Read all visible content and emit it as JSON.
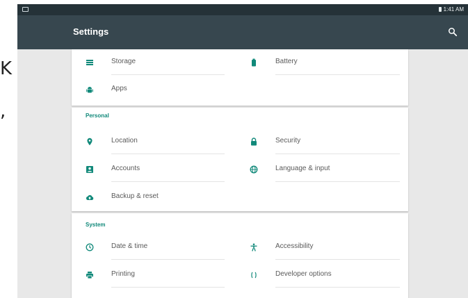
{
  "page": {
    "edge_text": [
      "K",
      ","
    ]
  },
  "status_bar": {
    "time": "1:41 AM"
  },
  "app_bar": {
    "title": "Settings"
  },
  "sections": [
    {
      "title": "",
      "items": [
        {
          "label": "Storage",
          "icon": "storage-icon"
        },
        {
          "label": "Battery",
          "icon": "battery-icon"
        },
        {
          "label": "Apps",
          "icon": "android-icon"
        }
      ]
    },
    {
      "title": "Personal",
      "items": [
        {
          "label": "Location",
          "icon": "location-icon"
        },
        {
          "label": "Security",
          "icon": "lock-icon"
        },
        {
          "label": "Accounts",
          "icon": "account-box-icon"
        },
        {
          "label": "Language & input",
          "icon": "globe-icon"
        },
        {
          "label": "Backup & reset",
          "icon": "cloud-upload-icon"
        }
      ]
    },
    {
      "title": "System",
      "items": [
        {
          "label": "Date & time",
          "icon": "clock-icon"
        },
        {
          "label": "Accessibility",
          "icon": "accessibility-icon"
        },
        {
          "label": "Printing",
          "icon": "printer-icon"
        },
        {
          "label": "Developer options",
          "icon": "code-braces-icon"
        }
      ]
    }
  ],
  "colors": {
    "status_bar": "#253238",
    "app_bar": "#37474f",
    "accent": "#11897a",
    "card": "#ffffff",
    "background": "#e8e8e8"
  }
}
